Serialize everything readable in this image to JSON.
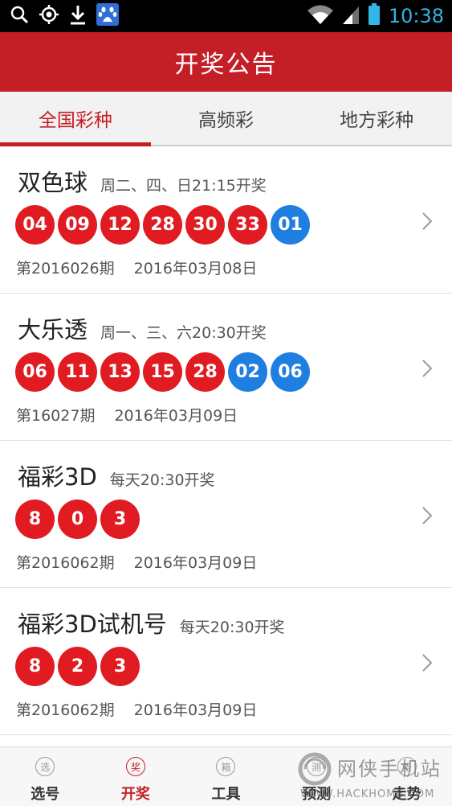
{
  "status_bar": {
    "time": "10:38",
    "icons": [
      "search-icon",
      "gps-icon",
      "download-icon",
      "baidu-paw-icon",
      "wifi-icon",
      "signal-icon",
      "battery-icon"
    ]
  },
  "header": {
    "title": "开奖公告"
  },
  "tabs": [
    {
      "label": "全国彩种",
      "active": true
    },
    {
      "label": "高频彩",
      "active": false
    },
    {
      "label": "地方彩种",
      "active": false
    }
  ],
  "lotteries": [
    {
      "name": "双色球",
      "schedule": "周二、四、日21:15开奖",
      "balls": [
        {
          "n": "04",
          "c": "red"
        },
        {
          "n": "09",
          "c": "red"
        },
        {
          "n": "12",
          "c": "red"
        },
        {
          "n": "28",
          "c": "red"
        },
        {
          "n": "30",
          "c": "red"
        },
        {
          "n": "33",
          "c": "red"
        },
        {
          "n": "01",
          "c": "blue"
        }
      ],
      "issue": "第2016026期",
      "date": "2016年03月08日"
    },
    {
      "name": "大乐透",
      "schedule": "周一、三、六20:30开奖",
      "balls": [
        {
          "n": "06",
          "c": "red"
        },
        {
          "n": "11",
          "c": "red"
        },
        {
          "n": "13",
          "c": "red"
        },
        {
          "n": "15",
          "c": "red"
        },
        {
          "n": "28",
          "c": "red"
        },
        {
          "n": "02",
          "c": "blue"
        },
        {
          "n": "06",
          "c": "blue"
        }
      ],
      "issue": "第16027期",
      "date": "2016年03月09日"
    },
    {
      "name": "福彩3D",
      "schedule": "每天20:30开奖",
      "balls": [
        {
          "n": "8",
          "c": "red"
        },
        {
          "n": "0",
          "c": "red"
        },
        {
          "n": "3",
          "c": "red"
        }
      ],
      "issue": "第2016062期",
      "date": "2016年03月09日"
    },
    {
      "name": "福彩3D试机号",
      "schedule": "每天20:30开奖",
      "balls": [
        {
          "n": "8",
          "c": "red"
        },
        {
          "n": "2",
          "c": "red"
        },
        {
          "n": "3",
          "c": "red"
        }
      ],
      "issue": "第2016062期",
      "date": "2016年03月09日"
    }
  ],
  "bottom_nav": [
    {
      "label": "选号",
      "icon_char": "选",
      "active": false
    },
    {
      "label": "开奖",
      "icon_char": "奖",
      "active": true
    },
    {
      "label": "工具",
      "icon_char": "箱",
      "active": false
    },
    {
      "label": "预测",
      "icon_char": "测",
      "active": false
    },
    {
      "label": "走势",
      "icon_char": "势",
      "active": false
    }
  ],
  "watermark": {
    "text": "网侠手机站",
    "url": "WWW.HACKHOME.COM"
  },
  "colors": {
    "brand_red": "#c41f26",
    "ball_red": "#e01b22",
    "ball_blue": "#1f7fe0",
    "status_accent": "#33b5e5"
  }
}
